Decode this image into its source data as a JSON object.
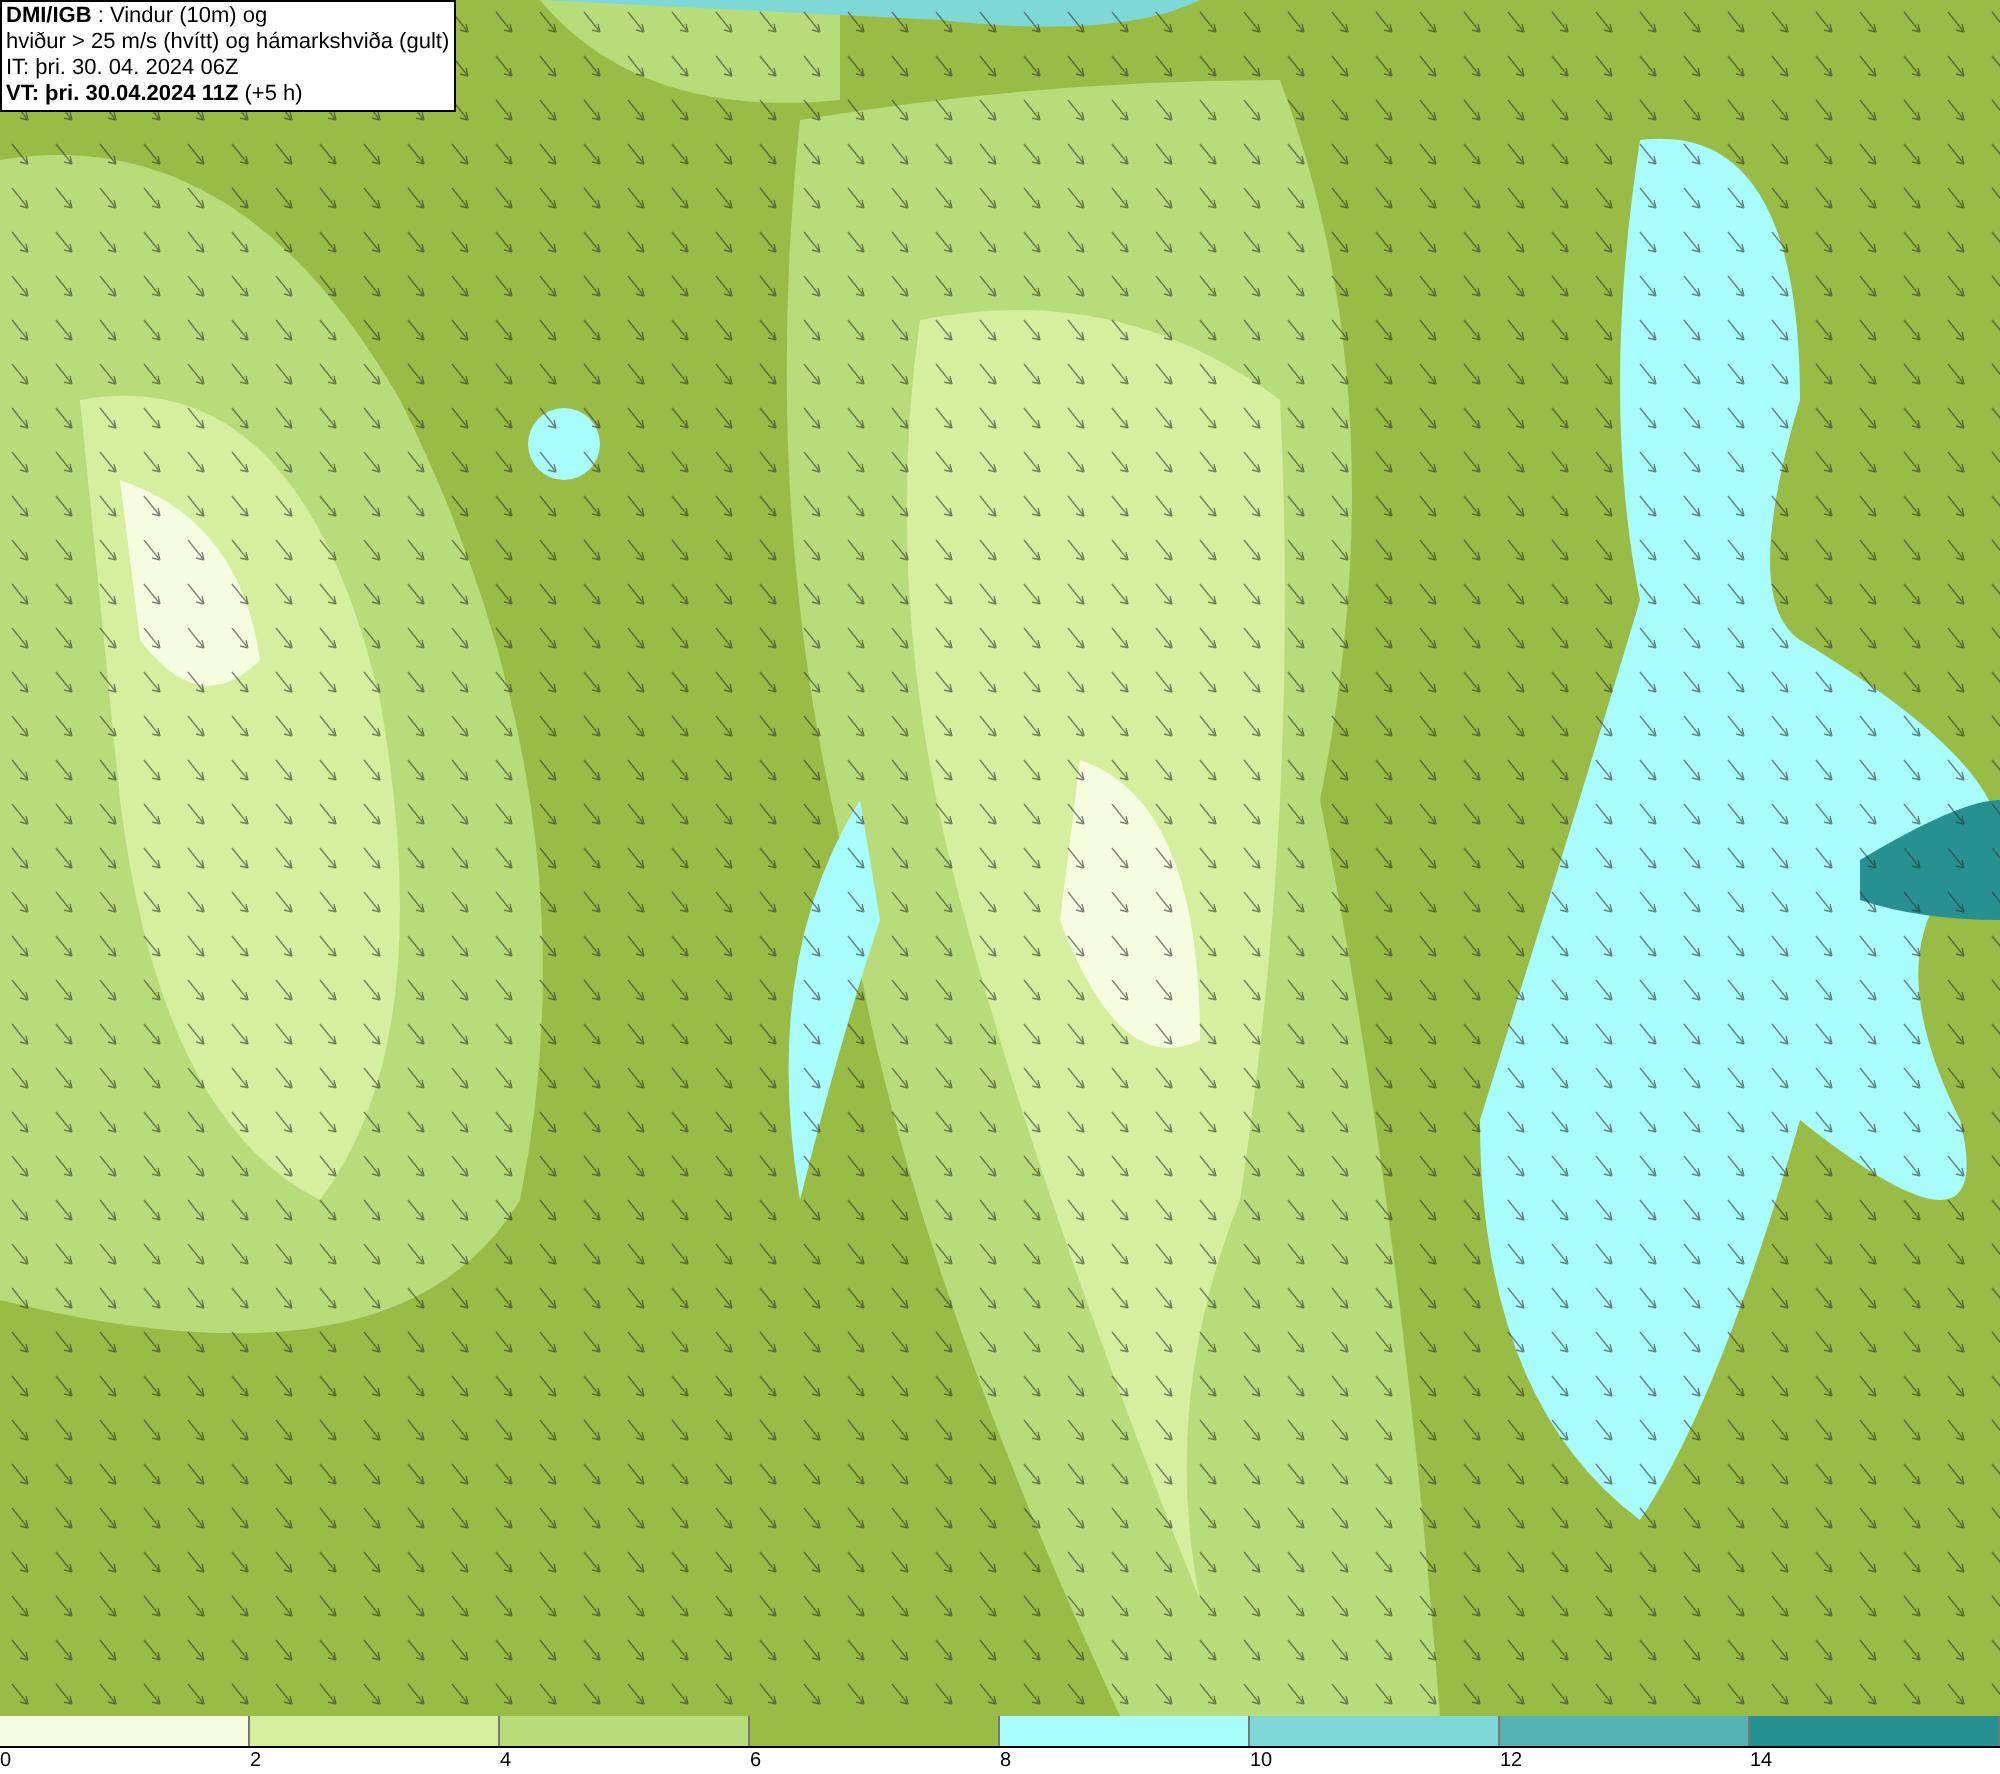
{
  "header": {
    "lines": [
      "**DMI/IGB** : Vindur (10m) og",
      "hviður > 25 m/s (hvítt) og hámarkshviða (gult)",
      "IT: þri. 30. 04. 2024 06Z",
      "**VT: þri. 30.04.2024 11Z** (+5 h)"
    ]
  },
  "legend": {
    "bins": [
      {
        "color": "#f5fcdf"
      },
      {
        "color": "#d6ef9f"
      },
      {
        "color": "#b8dc7a"
      },
      {
        "color": "#98bc45"
      },
      {
        "color": "#a9fcfc"
      },
      {
        "color": "#7fd8d8"
      },
      {
        "color": "#55b3b3"
      },
      {
        "color": "#279191"
      }
    ],
    "ticks": [
      "0",
      "2",
      "4",
      "6",
      "8",
      "10",
      "12",
      "14"
    ]
  }
}
